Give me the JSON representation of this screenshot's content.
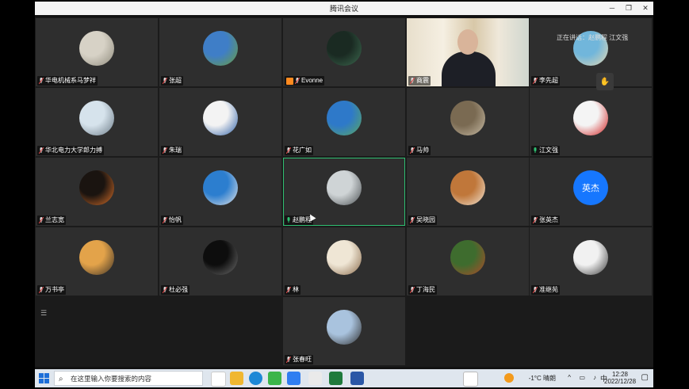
{
  "window": {
    "title": "腾讯会议"
  },
  "speaking": {
    "text": "正在讲话：赵鹏程 江文强"
  },
  "participants": [
    {
      "name": "华电机械系马梦祥",
      "av": "#d7d2c6",
      "av2": "#8e8a7c"
    },
    {
      "name": "张超",
      "av": "#3f7ec7",
      "av2": "#6a9d3f"
    },
    {
      "name": "Evonne",
      "av": "#1a2a22",
      "av2": "#3d6a50",
      "badge": "#ff8a1f"
    },
    {
      "name": "商震",
      "video": true
    },
    {
      "name": "李先超",
      "av": "#71b6db",
      "av2": "#e7d8b1"
    },
    {
      "name": "华北电力大学郎力搏",
      "av": "#d6e3ec",
      "av2": "#6b7a86"
    },
    {
      "name": "朱瑞",
      "av": "#f3f3f3",
      "av2": "#2d5fa6"
    },
    {
      "name": "花广如",
      "av": "#2e79c9",
      "av2": "#5aa860"
    },
    {
      "name": "马帅",
      "av": "#7a6a52",
      "av2": "#c8bca6"
    },
    {
      "name": "江文强",
      "av": "#f4f4f4",
      "av2": "#d21d1d",
      "speaking": true
    },
    {
      "name": "兰志宽",
      "av": "#1a1410",
      "av2": "#d9702a"
    },
    {
      "name": "怡帆",
      "av": "#2c7ecf",
      "av2": "#e5e5e5"
    },
    {
      "name": "赵鹏程",
      "av": "#cfd4d6",
      "av2": "#4a4f52",
      "speaking": true,
      "active": true
    },
    {
      "name": "吴晓园",
      "av": "#c0773a",
      "av2": "#f1e6d6"
    },
    {
      "name": "张英杰",
      "text": "英杰",
      "av": "#1677ff",
      "av2": "#1677ff"
    },
    {
      "name": "万书亭",
      "av": "#e3a34a",
      "av2": "#3a3026"
    },
    {
      "name": "杜必强",
      "av": "#0d0d0d",
      "av2": "#6e6e6e"
    },
    {
      "name": "林",
      "av": "#efe6d5",
      "av2": "#8a6a4a"
    },
    {
      "name": "丁海民",
      "av": "#3e6c2e",
      "av2": "#b04a2a"
    },
    {
      "name": "准继苑",
      "av": "#f1f1f1",
      "av2": "#3a3a3a"
    },
    {
      "name": "张春旺",
      "av": "#a9c3de",
      "av2": "#2e2e2e"
    }
  ],
  "taskbar": {
    "search_placeholder": "在这里输入你要搜索的内容",
    "weather": "-1°C 晴朗",
    "ime": "中",
    "time": "12:28",
    "date": "2022/12/28"
  },
  "colors": {
    "active_border": "#2fbf71",
    "mic_active": "#2fbf71",
    "mic_muted": "#e24a4a"
  }
}
